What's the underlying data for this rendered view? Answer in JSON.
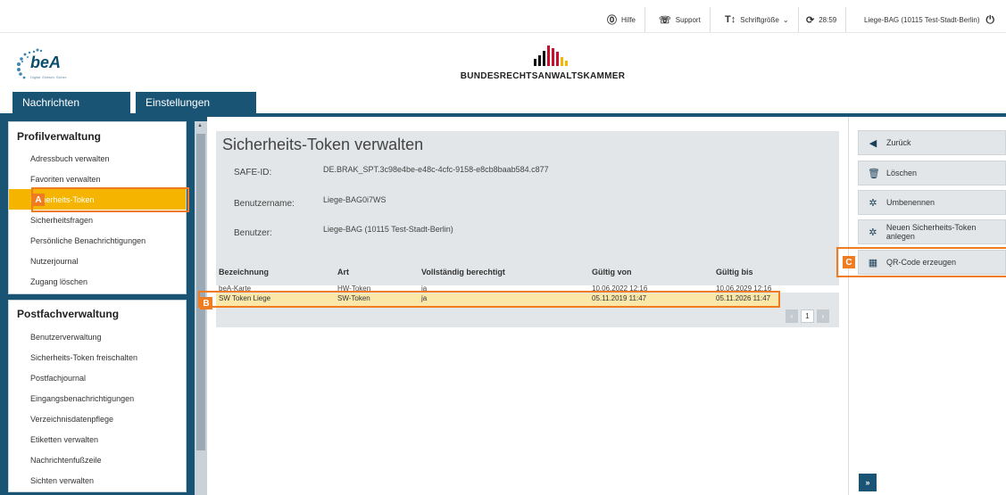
{
  "topbar": {
    "help": "Hilfe",
    "support": "Support",
    "font_size": "Schriftgröße",
    "timer": "28:59",
    "user": "Liege-BAG (10115 Test-Stadt-Berlin)"
  },
  "header": {
    "bea_logo_text": "beA",
    "bea_logo_sub": "Digital. Einfach. Sicher.",
    "brak_text": "BUNDESRECHTSANWALTSKAMMER"
  },
  "nav": {
    "tabs": [
      "Nachrichten",
      "Einstellungen"
    ]
  },
  "sidebar": {
    "profil_title": "Profilverwaltung",
    "profil_items": [
      "Adressbuch verwalten",
      "Favoriten verwalten",
      "Sicherheits-Token",
      "Sicherheitsfragen",
      "Persönliche Benachrichtigungen",
      "Nutzerjournal",
      "Zugang löschen"
    ],
    "postfach_title": "Postfachverwaltung",
    "postfach_items": [
      "Benutzerverwaltung",
      "Sicherheits-Token freischalten",
      "Postfachjournal",
      "Eingangsbenachrichtigungen",
      "Verzeichnisdatenpflege",
      "Etiketten verwalten",
      "Nachrichtenfußzeile",
      "Sichten verwalten"
    ]
  },
  "main": {
    "title": "Sicherheits-Token verwalten",
    "fields": [
      {
        "label": "SAFE-ID:",
        "value": "DE.BRAK_SPT.3c98e4be-e48c-4cfc-9158-e8cb8baab584.c877"
      },
      {
        "label": "Benutzername:",
        "value": "Liege-BAG0i7WS"
      },
      {
        "label": "Benutzer:",
        "value": "Liege-BAG (10115 Test-Stadt-Berlin)"
      }
    ],
    "table": {
      "headers": [
        "Bezeichnung",
        "Art",
        "Vollständig berechtigt",
        "Gültig von",
        "Gültig bis"
      ],
      "rows": [
        [
          "beA-Karte",
          "HW-Token",
          "ja",
          "10.06.2022 12:16",
          "10.06.2029 12:16"
        ],
        [
          "SW Token Liege",
          "SW-Token",
          "ja",
          "05.11.2019 11:47",
          "05.11.2026 11:47"
        ]
      ]
    },
    "pager": {
      "prev": "‹",
      "page": "1",
      "next": "›"
    }
  },
  "actions": {
    "buttons": [
      "Zurück",
      "Löschen",
      "Umbenennen",
      "Neuen Sicherheits-Token anlegen",
      "QR-Code erzeugen"
    ],
    "expand": "»"
  },
  "markers": {
    "a": "A",
    "b": "B",
    "c": "C"
  },
  "colors": {
    "primary": "#1a5475",
    "active": "#f4b400",
    "highlight": "#f07c22",
    "selected_row": "#fbe8a9"
  }
}
